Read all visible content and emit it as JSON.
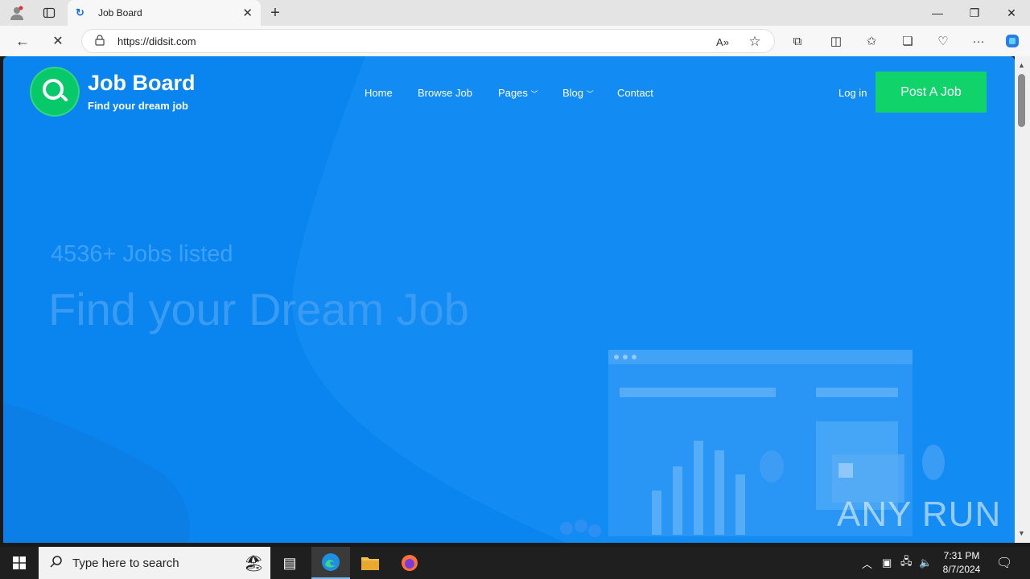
{
  "browser": {
    "tab_title": "Job Board",
    "url": "https://didsit.com"
  },
  "site": {
    "brand": "Job Board",
    "tagline": "Find your dream job",
    "nav": [
      "Home",
      "Browse Job",
      "Pages",
      "Blog",
      "Contact"
    ],
    "login_label": "Log in",
    "post_job_label": "Post A Job",
    "hero_count": "4536+ Jobs listed",
    "hero_title": "Find your Dream Job",
    "watermark": "ANY RUN"
  },
  "taskbar": {
    "search_placeholder": "Type here to search",
    "time": "7:31 PM",
    "date": "8/7/2024"
  },
  "colors": {
    "hero_bg": "#0a85ef",
    "accent_green": "#10d46a"
  }
}
